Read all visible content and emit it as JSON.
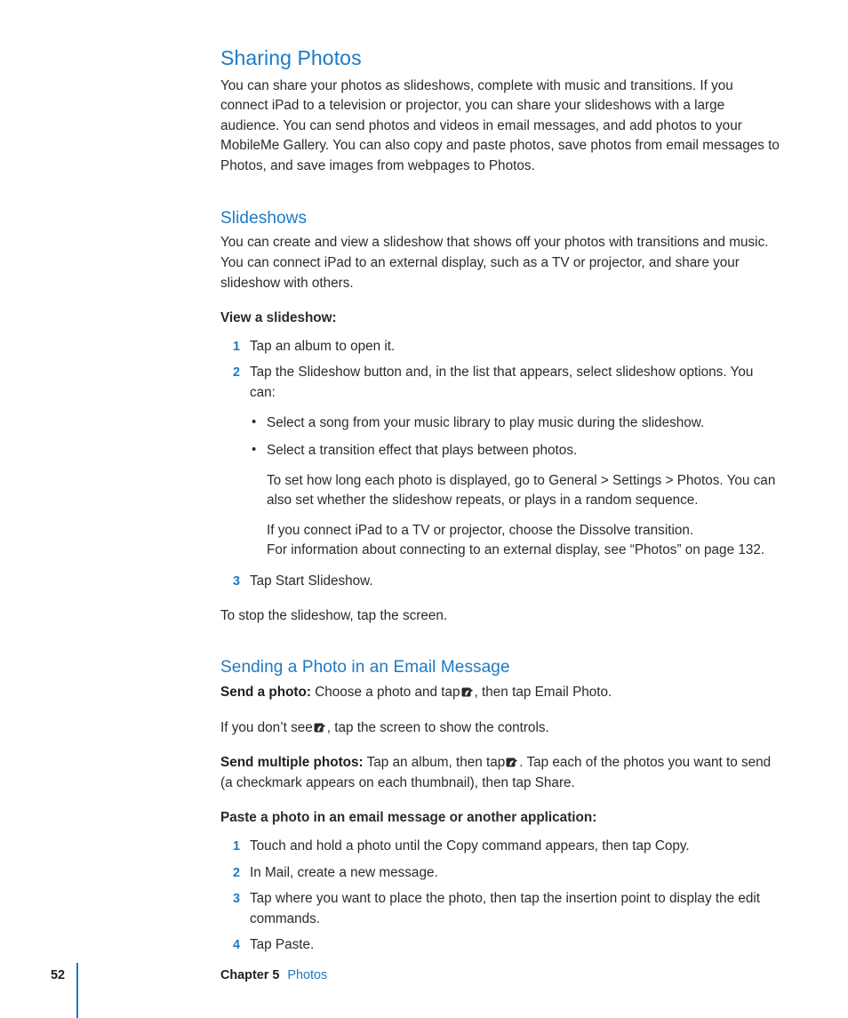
{
  "document": {
    "section": {
      "title": "Sharing Photos",
      "intro": "You can share your photos as slideshows, complete with music and transitions. If you connect iPad to a television or projector, you can share your slideshows with a large audience. You can send photos and videos in email messages, and add photos to your MobileMe Gallery. You can also copy and paste photos, save photos from email messages to Photos, and save images from webpages to Photos."
    },
    "slideshows": {
      "title": "Slideshows",
      "intro": "You can create and view a slideshow that shows off your photos with transitions and music. You can connect iPad to an external display, such as a TV or projector, and share your slideshow with others.",
      "procedure_label": "View a slideshow:",
      "steps": [
        {
          "num": "1",
          "text": "Tap an album to open it."
        },
        {
          "num": "2",
          "text": "Tap the Slideshow button and, in the list that appears, select slideshow options. You can:"
        },
        {
          "num": "3",
          "text": "Tap Start Slideshow."
        }
      ],
      "bullets": [
        "Select a song from your music library to play music during the slideshow.",
        "Select a transition effect that plays between photos."
      ],
      "note_1": "To set how long each photo is displayed, go to General > Settings > Photos. You can also set whether the slideshow repeats, or plays in a random sequence.",
      "note_2": "If you connect iPad to a TV or projector, choose the Dissolve transition.",
      "note_3": "For information about connecting to an external display, see “Photos” on page 132.",
      "closing": "To stop the slideshow, tap the screen."
    },
    "email": {
      "title": "Sending a Photo in an Email Message",
      "send_photo_label": "Send a photo:",
      "send_photo_text_before": "Choose a photo and tap",
      "send_photo_text_after": ", then tap Email Photo.",
      "no_icon_text_before": "If you don’t see",
      "no_icon_text_after": ", tap the screen to show the controls.",
      "send_multiple_label": "Send multiple photos:",
      "send_multiple_before": "Tap an album, then tap",
      "send_multiple_after": ". Tap each of the photos you want to send (a checkmark appears on each thumbnail), then tap Share.",
      "paste_label": "Paste a photo in an email message or another application:",
      "paste_steps": [
        {
          "num": "1",
          "text": "Touch and hold a photo until the Copy command appears, then tap Copy."
        },
        {
          "num": "2",
          "text": "In Mail, create a new message."
        },
        {
          "num": "3",
          "text": "Tap where you want to place the photo, then tap the insertion point to display the edit commands."
        },
        {
          "num": "4",
          "text": "Tap Paste."
        }
      ]
    },
    "footer": {
      "page_number": "52",
      "chapter_label": "Chapter 5",
      "chapter_name": "Photos"
    },
    "icons": {
      "share": "share-export-icon",
      "bullet": "•"
    },
    "colors": {
      "heading_blue": "#1d7ac4",
      "body_text": "#2b2b2b",
      "bold_text": "#1f1f1f"
    }
  }
}
